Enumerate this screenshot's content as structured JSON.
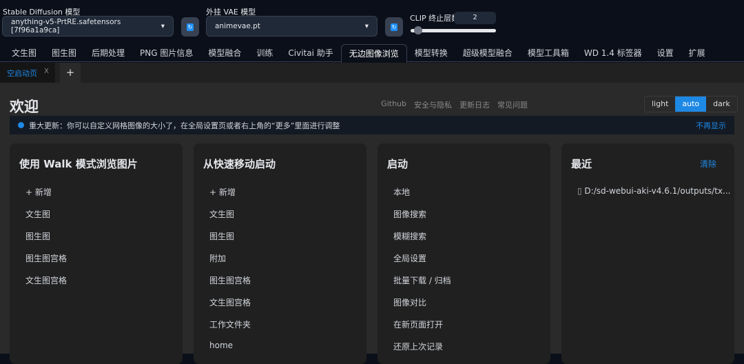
{
  "top": {
    "sd_label": "Stable Diffusion 模型",
    "sd_value": "anything-v5-PrtRE.safetensors [7f96a1a9ca]",
    "vae_label": "外挂 VAE 模型",
    "vae_value": "animevae.pt",
    "clip_label": "CLIP 终止层数",
    "clip_value": "2",
    "clip_min": 1,
    "clip_max": 12
  },
  "tabs": [
    "文生图",
    "图生图",
    "后期处理",
    "PNG 图片信息",
    "模型融合",
    "训练",
    "Civitai 助手",
    "无边图像浏览",
    "模型转换",
    "超级模型融合",
    "模型工具箱",
    "WD 1.4 标签器",
    "设置",
    "扩展"
  ],
  "active_tab": "无边图像浏览",
  "subtab": {
    "label": "空启动页",
    "close": "X",
    "add": "+"
  },
  "welcome": {
    "title": "欢迎",
    "links": [
      "Github",
      "安全与隐私",
      "更新日志",
      "常见问题"
    ],
    "themes": [
      "light",
      "auto",
      "dark"
    ],
    "active_theme": "auto"
  },
  "notice": {
    "text": "重大更新：你可以自定义网格图像的大小了，在全局设置页或者右上角的“更多”里面进行调整",
    "dismiss": "不再显示"
  },
  "cards": [
    {
      "title": "使用 Walk 模式浏览图片",
      "items": [
        "+ 新增",
        "文生图",
        "图生图",
        "图生图宫格",
        "文生图宫格"
      ]
    },
    {
      "title": "从快速移动启动",
      "items": [
        "+ 新增",
        "文生图",
        "图生图",
        "附加",
        "图生图宫格",
        "文生图宫格",
        "工作文件夹",
        "home"
      ]
    },
    {
      "title": "启动",
      "items": [
        "本地",
        "图像搜索",
        "模糊搜索",
        "全局设置",
        "批量下载 / 归档",
        "图像对比",
        "在新页面打开",
        "还原上次记录"
      ]
    },
    {
      "title": "最近",
      "action": "清除",
      "items": [
        "D:/sd-webui-aki-v4.6.1/outputs/tx..."
      ]
    }
  ],
  "colors": {
    "accent": "#1e88e5",
    "bg": "#0b0f19"
  }
}
